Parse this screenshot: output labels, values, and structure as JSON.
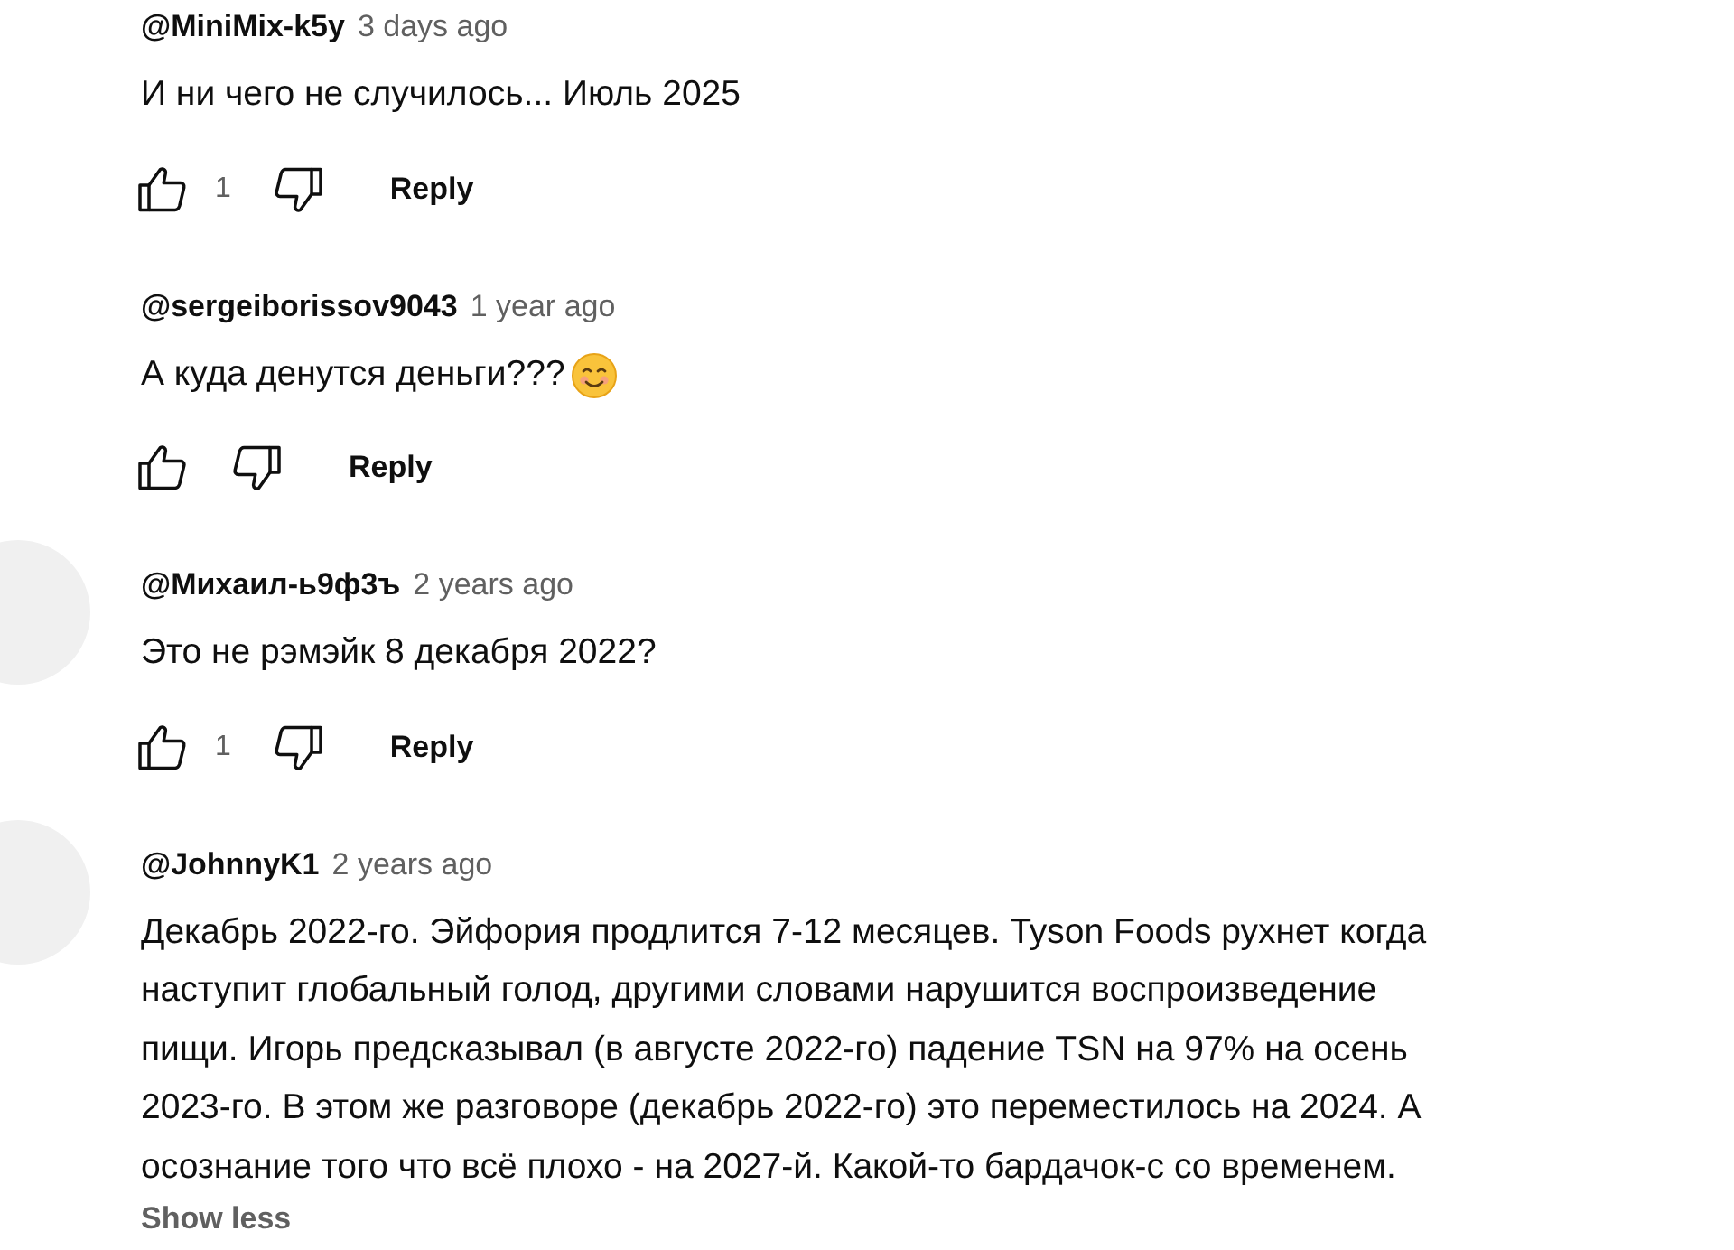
{
  "comments": [
    {
      "author": "@MiniMix-k5y",
      "time": "3 days ago",
      "text": "И ни чего не случилось... Июль 2025",
      "avatar": false,
      "likes": "1",
      "reply": "Reply"
    },
    {
      "author": "@sergeiborissov9043",
      "time": "1 year ago",
      "text": "А куда денутся деньги???",
      "smiley": true,
      "avatar": false,
      "reply": "Reply"
    },
    {
      "author": "@Михаил-ь9ф3ъ",
      "time": "2 years ago",
      "text": "Это не рэмэйк 8 декабря 2022?",
      "avatar": true,
      "likes": "1",
      "reply": "Reply"
    },
    {
      "author": "@JohnnyK1",
      "time": "2 years ago",
      "text": "Декабрь 2022-го. Эйфория продлится 7-12 месяцев. Tyson Foods рухнет когда\nнаступит глобальный голод, другими словами нарушится воспроизведение\nпищи. Игорь предсказывал (в августе 2022-го) падение TSN на 97% на осень\n2023-го. В этом же разговоре (декабрь 2022-го) это переместилось на 2024. А\nосознание того что всё плохо - на 2027-й. Какой-то бардачок-с со временем.",
      "avatar": true,
      "toggle": "Show less"
    }
  ]
}
